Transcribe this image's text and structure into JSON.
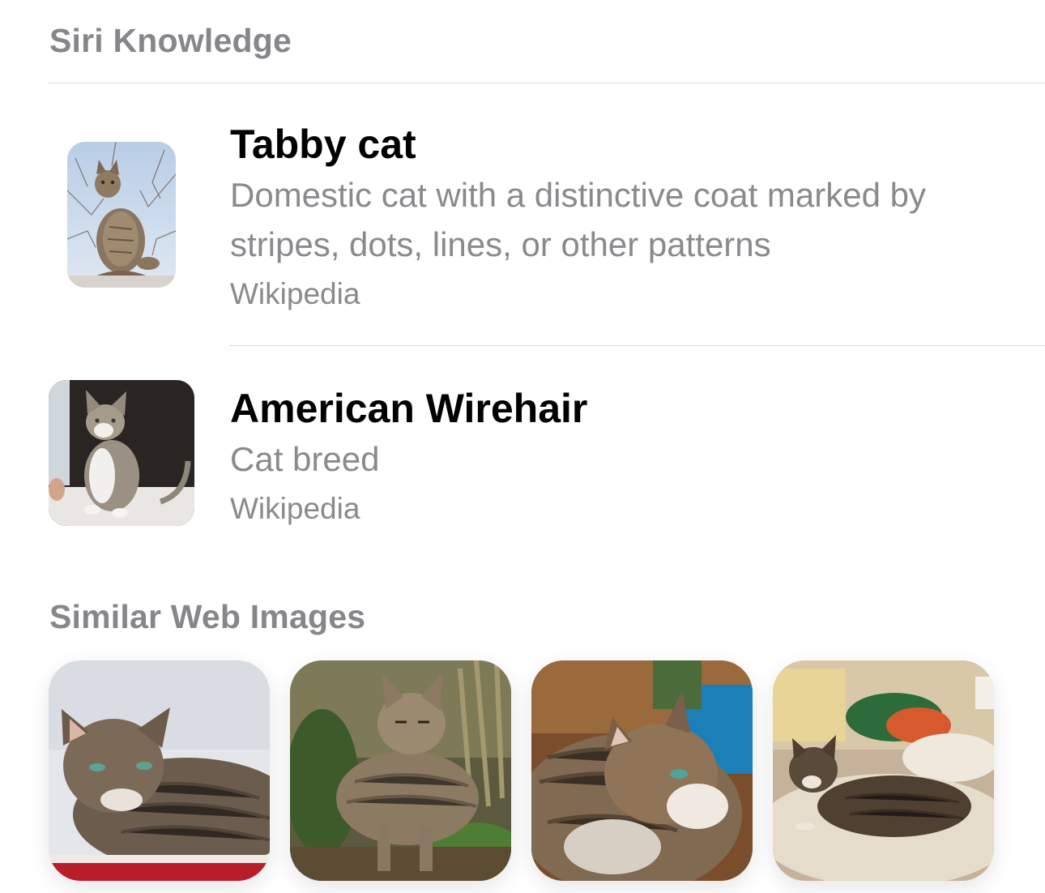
{
  "sections": {
    "siri_knowledge": {
      "header": "Siri Knowledge"
    },
    "similar_web_images": {
      "header": "Similar Web Images"
    }
  },
  "results": [
    {
      "title": "Tabby cat",
      "description": "Domestic cat with a distinctive coat marked by stripes, dots, lines, or other patterns",
      "source": "Wikipedia"
    },
    {
      "title": "American Wirehair",
      "description": "Cat breed",
      "source": "Wikipedia"
    }
  ],
  "web_images_count": 4,
  "colors": {
    "header_gray": "#86868b",
    "secondary_text": "#8a8a8e",
    "title_text": "#000000",
    "divider": "#dcdce0",
    "background": "#ffffff"
  }
}
